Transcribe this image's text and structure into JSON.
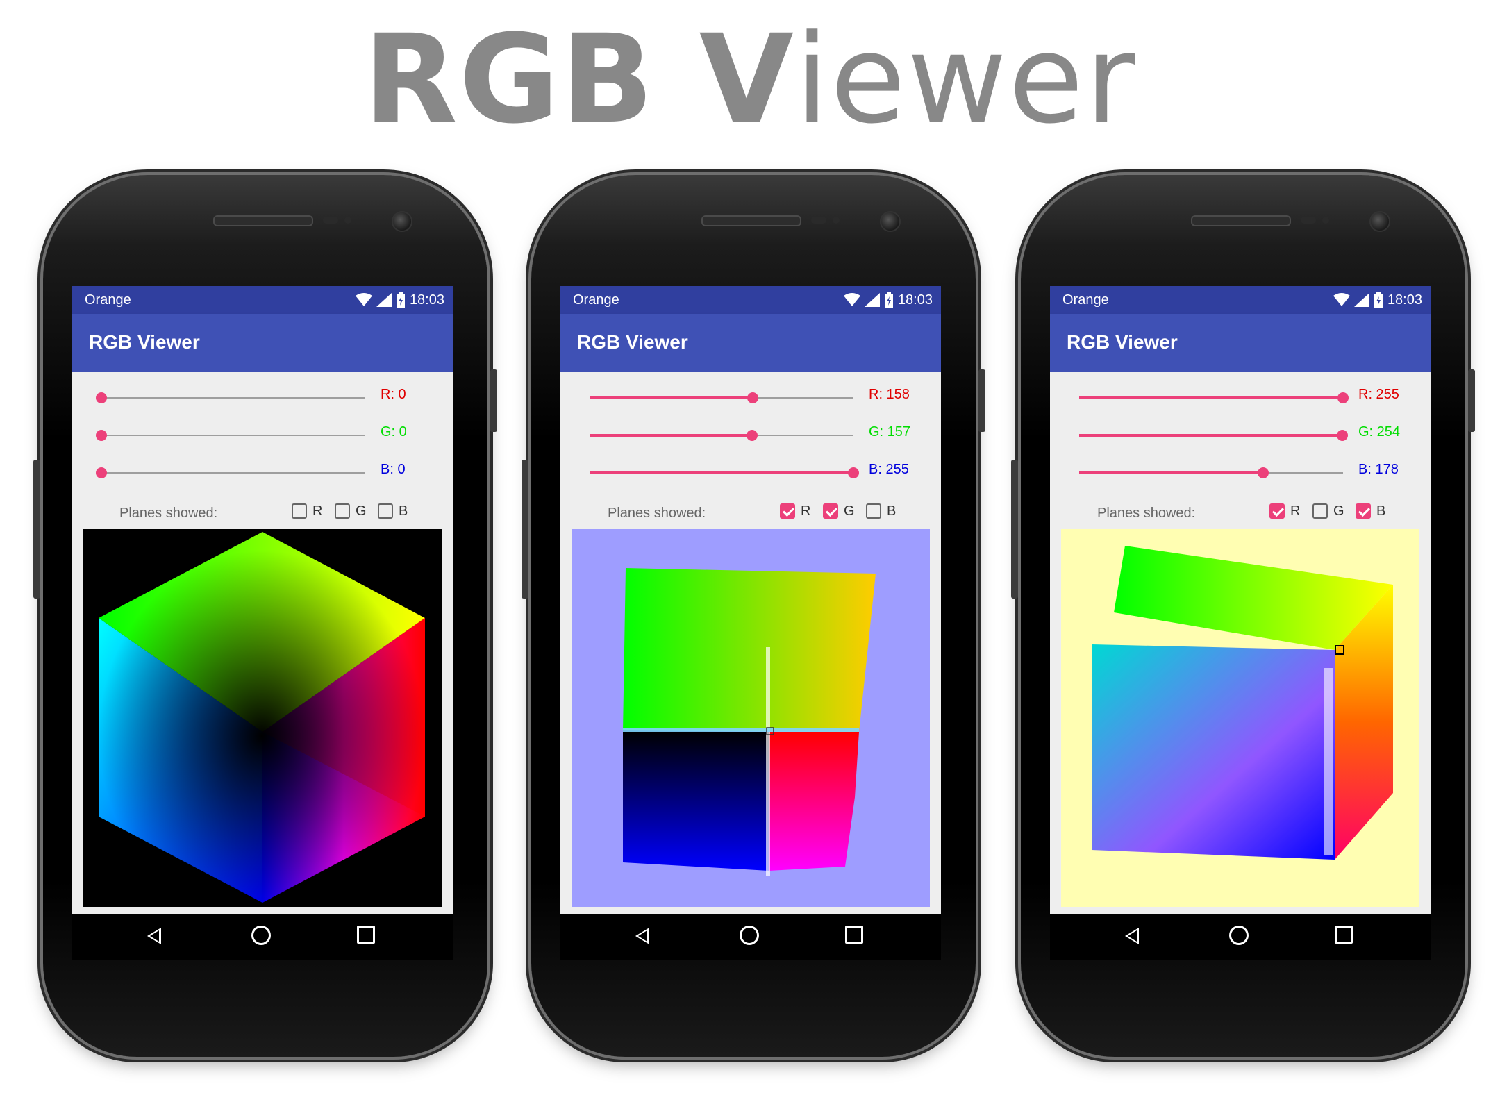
{
  "hero": {
    "title_bold": "RGB V",
    "title_light": "iewer"
  },
  "phones": [
    {
      "status": {
        "carrier": "Orange",
        "time": "18:03"
      },
      "app_title": "RGB Viewer",
      "sliders": [
        {
          "label": "R: 0",
          "value": 0,
          "max": 255
        },
        {
          "label": "G: 0",
          "value": 0,
          "max": 255
        },
        {
          "label": "B: 0",
          "value": 0,
          "max": 255
        }
      ],
      "planes_label": "Planes showed:",
      "planes": [
        {
          "letter": "R",
          "checked": false
        },
        {
          "letter": "G",
          "checked": false
        },
        {
          "letter": "B",
          "checked": false
        }
      ],
      "view_background": "#000000"
    },
    {
      "status": {
        "carrier": "Orange",
        "time": "18:03"
      },
      "app_title": "RGB Viewer",
      "sliders": [
        {
          "label": "R: 158",
          "value": 158,
          "max": 255
        },
        {
          "label": "G: 157",
          "value": 157,
          "max": 255
        },
        {
          "label": "B: 255",
          "value": 255,
          "max": 255
        }
      ],
      "planes_label": "Planes showed:",
      "planes": [
        {
          "letter": "R",
          "checked": true
        },
        {
          "letter": "G",
          "checked": true
        },
        {
          "letter": "B",
          "checked": false
        }
      ],
      "view_background": "#9e9dff"
    },
    {
      "status": {
        "carrier": "Orange",
        "time": "18:03"
      },
      "app_title": "RGB Viewer",
      "sliders": [
        {
          "label": "R: 255",
          "value": 255,
          "max": 255
        },
        {
          "label": "G: 254",
          "value": 254,
          "max": 255
        },
        {
          "label": "B: 178",
          "value": 178,
          "max": 255
        }
      ],
      "planes_label": "Planes showed:",
      "planes": [
        {
          "letter": "R",
          "checked": true
        },
        {
          "letter": "G",
          "checked": false
        },
        {
          "letter": "B",
          "checked": true
        }
      ],
      "view_background": "#fffeb2"
    }
  ],
  "colors": {
    "status_bar": "#303f9f",
    "app_bar": "#3f51b5",
    "accent": "#ec407a",
    "label_r": "#e00000",
    "label_g": "#00dd00",
    "label_b": "#0000dd"
  }
}
